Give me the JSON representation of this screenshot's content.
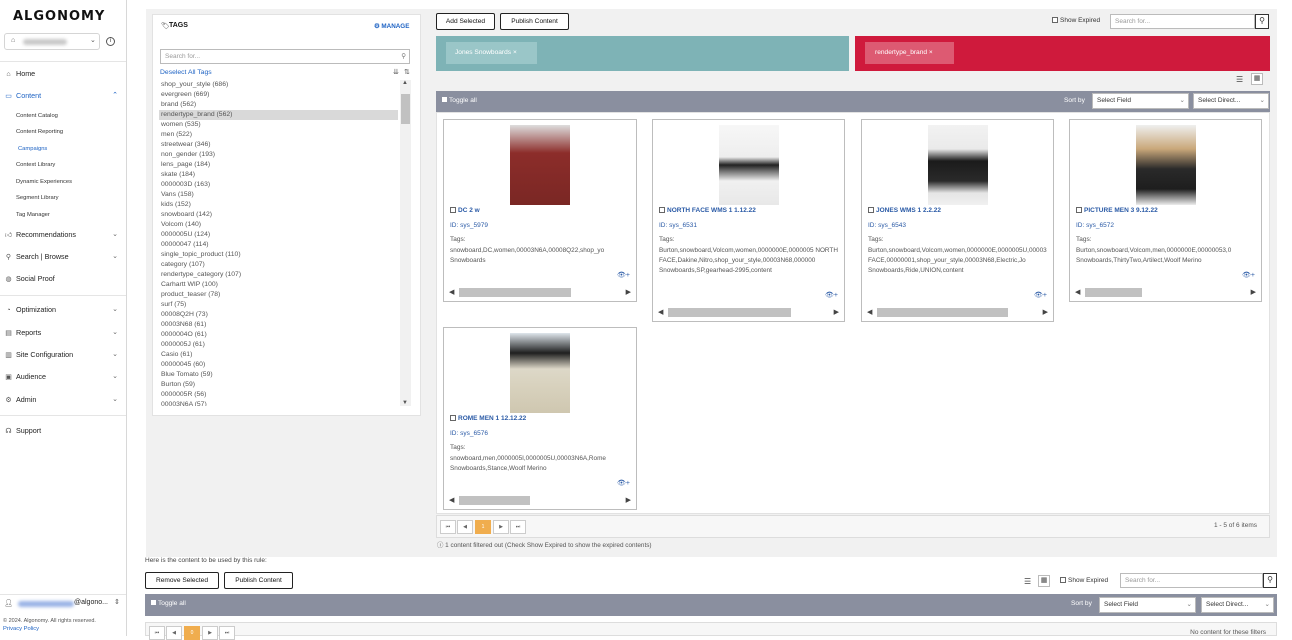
{
  "app": {
    "logo": "ALGONOMY"
  },
  "sidebar": {
    "items": [
      {
        "label": "Home",
        "icon": "home-icon"
      },
      {
        "label": "Content",
        "icon": "content-icon"
      },
      {
        "label": "Recommendations",
        "icon": "thumbs-up-icon"
      },
      {
        "label": "Search | Browse",
        "icon": "search-icon"
      },
      {
        "label": "Social Proof",
        "icon": "globe-icon"
      },
      {
        "label": "Optimization",
        "icon": "optimization-icon"
      },
      {
        "label": "Reports",
        "icon": "reports-icon"
      },
      {
        "label": "Site Configuration",
        "icon": "site-config-icon"
      },
      {
        "label": "Audience",
        "icon": "audience-icon"
      },
      {
        "label": "Admin",
        "icon": "admin-icon"
      },
      {
        "label": "Support",
        "icon": "support-icon"
      }
    ],
    "content_sub": [
      "Content Catalog",
      "Content Reporting",
      "Campaigns",
      "Context Library",
      "Dynamic Experiences",
      "Segment Library",
      "Tag Manager"
    ],
    "user_suffix": "@algono...",
    "copyright": "© 2024. Algonomy. All rights reserved.",
    "privacy": "Privacy Policy"
  },
  "tags_panel": {
    "title": "TAGS",
    "manage": "MANAGE",
    "search_placeholder": "Search for...",
    "deselect": "Deselect All Tags",
    "tags": [
      "shop_your_style (686)",
      "evergreen (669)",
      "brand (562)",
      "rendertype_brand (562)",
      "women (535)",
      "men (522)",
      "streetwear (346)",
      "non_gender (193)",
      "lens_page (184)",
      "skate (184)",
      "0000003D (163)",
      "Vans (158)",
      "kids (152)",
      "snowboard (142)",
      "Volcom (140)",
      "0000005U (124)",
      "00000047 (114)",
      "single_topic_product (110)",
      "category (107)",
      "rendertype_category (107)",
      "Carhartt WIP (100)",
      "product_teaser (78)",
      "surf (75)",
      "00008Q2H (73)",
      "00003N68 (61)",
      "0000004O (61)",
      "0000005J (61)",
      "Casio (61)",
      "00000045 (60)",
      "Blue Tomato (59)",
      "Burton (59)",
      "0000005R (56)",
      "00003N6A (57)"
    ]
  },
  "top_bar": {
    "add_selected": "Add Selected",
    "publish": "Publish Content",
    "show_expired": "Show Expired",
    "search_placeholder": "Search for..."
  },
  "filters": {
    "left": "Jones Snowboards",
    "right": "rendertype_brand",
    "remove": "×"
  },
  "results": {
    "toggle_all": "Toggle all",
    "sort_by": "Sort by",
    "select_field": "Select Field",
    "select_direction": "Select Direct...",
    "id_prefix": "ID: ",
    "tags_label": "Tags:",
    "cards": [
      {
        "title": "DC 2 w",
        "id": "sys_5979",
        "tags": "snowboard,DC,women,00003N6A,00008Q22,shop_yo Snowboards",
        "img_bg": "#8c2d2a"
      },
      {
        "title": "NORTH FACE WMS 1 1.12.22",
        "id": "sys_6531",
        "tags": "Burton,snowboard,Volcom,women,0000000E,0000005 NORTH FACE,Dakine,Nitro,shop_your_style,00003N68,000000 Snowboards,SP,gearhead-2995,content",
        "img_bg": "#f4f4f4"
      },
      {
        "title": "JONES WMS 1 2.2.22",
        "id": "sys_6543",
        "tags": "Burton,snowboard,Volcom,women,0000000E,0000005U,00003 FACE,00000001,shop_your_style,00003N68,Electric,Jo Snowboards,Ride,UNION,content",
        "img_bg": "#eaeaea"
      },
      {
        "title": "PICTURE MEN 3 9.12.22",
        "id": "sys_6572",
        "tags": "Burton,snowboard,Volcom,men,0000000E,00000053,0 Snowboards,ThirtyTwo,Artilect,Woolf Merino",
        "img_bg": "#e6e6e6"
      },
      {
        "title": "ROME MEN 1 12.12.22",
        "id": "sys_6576",
        "tags": "snowboard,men,0000005I,0000005U,00003N6A,Rome Snowboards,Stance,Woolf Merino",
        "img_bg": "#dfe6ec"
      }
    ],
    "page": "1",
    "items_count": "1 - 5 of 6 items",
    "filtered_note": "1 content filtered out (Check Show Expired to show the expired contents)"
  },
  "bottom": {
    "rule_text": "Here is the content to be used by this rule:",
    "remove_selected": "Remove Selected",
    "publish": "Publish Content",
    "show_expired": "Show Expired",
    "search_placeholder": "Search for...",
    "toggle_all": "Toggle all",
    "sort_by": "Sort by",
    "select_field": "Select Field",
    "select_direction": "Select Direct...",
    "no_content": "No content for these filters",
    "page": "0"
  },
  "colors": {
    "filter_left": "#7eb3b6",
    "filter_right": "#cf1a3c",
    "toolbar": "#8a8f9f",
    "accent": "#1e63c4",
    "page_active": "#f0ad4e"
  }
}
